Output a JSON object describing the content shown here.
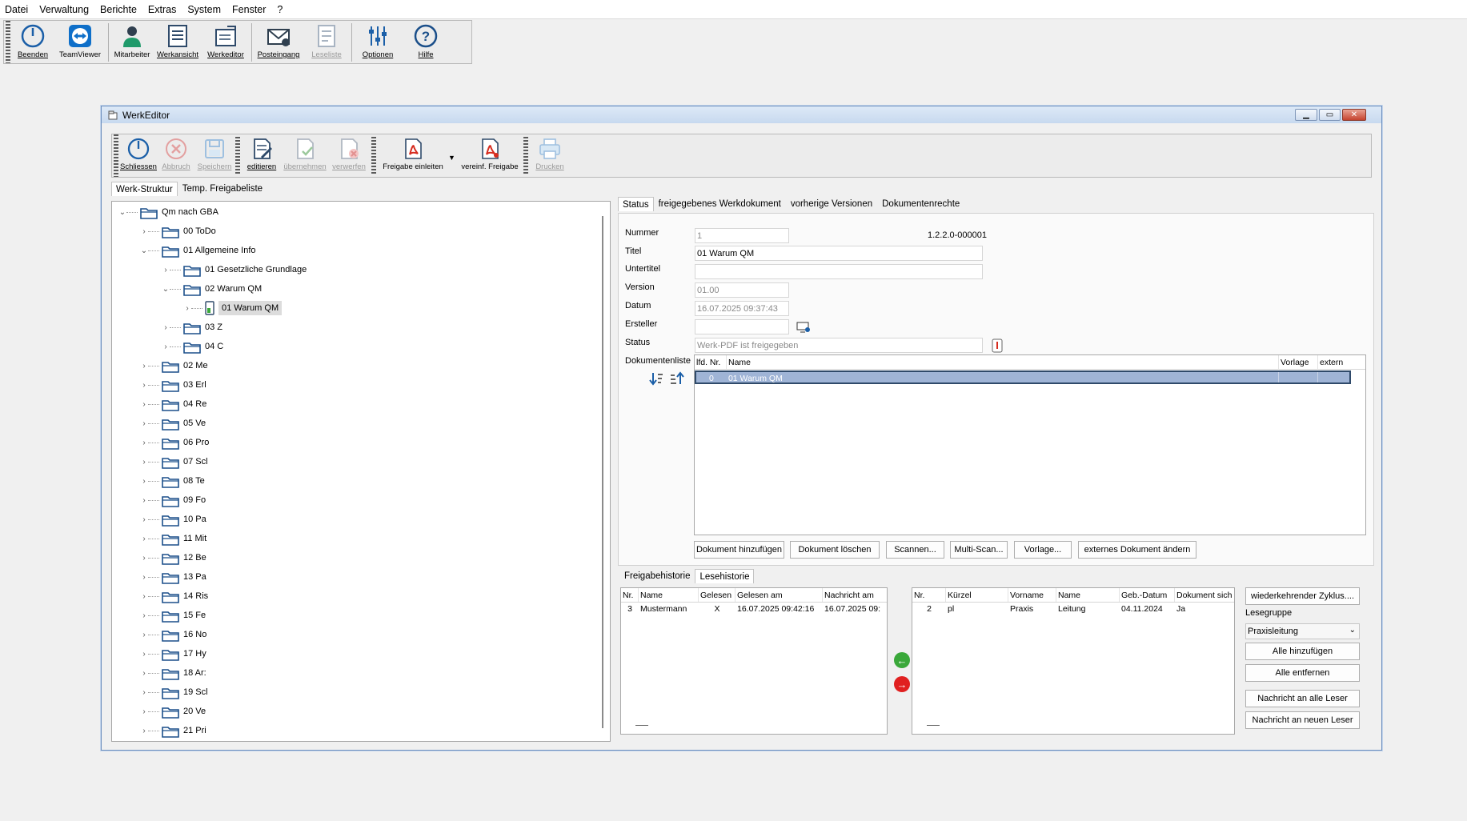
{
  "menu": [
    "Datei",
    "Verwaltung",
    "Berichte",
    "Extras",
    "System",
    "Fenster",
    "?"
  ],
  "main_toolbar": [
    {
      "label": "Beenden",
      "icon": "power-icon"
    },
    {
      "label": "TeamViewer",
      "icon": "teamviewer-icon"
    },
    {
      "label": "Mitarbeiter",
      "icon": "person-icon"
    },
    {
      "label": "Werkansicht",
      "icon": "document-list-icon"
    },
    {
      "label": "Werkeditor",
      "icon": "document-edit-icon"
    },
    {
      "label": "Posteingang",
      "icon": "mail-icon"
    },
    {
      "label": "Leseliste",
      "icon": "reading-list-icon"
    },
    {
      "label": "Optionen",
      "icon": "sliders-icon"
    },
    {
      "label": "Hilfe",
      "icon": "help-icon"
    }
  ],
  "window": {
    "title": "WerkEditor"
  },
  "editor_toolbar": [
    {
      "label": "Schliessen",
      "icon": "power-icon"
    },
    {
      "label": "Abbruch",
      "icon": "cancel-icon"
    },
    {
      "label": "Speichern",
      "icon": "save-icon"
    },
    {
      "label": "editieren",
      "icon": "edit-icon"
    },
    {
      "label": "übernehmen",
      "icon": "accept-icon"
    },
    {
      "label": "verwerfen",
      "icon": "discard-icon"
    },
    {
      "label": "Freigabe einleiten",
      "icon": "pdf-icon"
    },
    {
      "label": "vereinf. Freigabe",
      "icon": "pdf-icon"
    },
    {
      "label": "Drucken",
      "icon": "print-icon"
    }
  ],
  "left_tabs": [
    "Werk-Struktur",
    "Temp. Freigabeliste"
  ],
  "tree": [
    {
      "label": "Qm nach GBA",
      "expand": "v"
    },
    {
      "label": "00 ToDo",
      "expand": ">"
    },
    {
      "label": "01 Allgemeine Info",
      "expand": "v"
    },
    {
      "label": "01 Gesetzliche Grundlage",
      "expand": ">"
    },
    {
      "label": "02 Warum QM",
      "expand": "v"
    },
    {
      "label": "01 Warum QM",
      "expand": ">"
    },
    {
      "label": "03 Z",
      "expand": ">"
    },
    {
      "label": "04 C",
      "expand": ">"
    },
    {
      "label": "02 Me",
      "expand": ">"
    },
    {
      "label": "03 Erl",
      "expand": ">"
    },
    {
      "label": "04 Re",
      "expand": ">"
    },
    {
      "label": "05 Ve",
      "expand": ">"
    },
    {
      "label": "06 Pro",
      "expand": ">"
    },
    {
      "label": "07 Scl",
      "expand": ">"
    },
    {
      "label": "08 Te",
      "expand": ">"
    },
    {
      "label": "09 Fo",
      "expand": ">"
    },
    {
      "label": "10 Pa",
      "expand": ">"
    },
    {
      "label": "11 Mit",
      "expand": ">"
    },
    {
      "label": "12 Be",
      "expand": ">"
    },
    {
      "label": "13 Pa",
      "expand": ">"
    },
    {
      "label": "14 Ris",
      "expand": ">"
    },
    {
      "label": "15 Fe",
      "expand": ">"
    },
    {
      "label": "16 No",
      "expand": ">"
    },
    {
      "label": "17 Hy",
      "expand": ">"
    },
    {
      "label": "18 Ar:",
      "expand": ">"
    },
    {
      "label": "19 Scl",
      "expand": ">"
    },
    {
      "label": "20 Ve",
      "expand": ">"
    },
    {
      "label": "21 Pri",
      "expand": ">"
    }
  ],
  "right_tabs": [
    "Status",
    "freigegebenes Werkdokument",
    "vorherige Versionen",
    "Dokumentenrechte"
  ],
  "form": {
    "nummer_label": "Nummer",
    "nummer": "1",
    "code": "1.2.2.0-000001",
    "titel_label": "Titel",
    "titel": "01 Warum QM",
    "untertitel_label": "Untertitel",
    "untertitel": "",
    "version_label": "Version",
    "version": "01.00",
    "datum_label": "Datum",
    "datum": "16.07.2025 09:37:43",
    "ersteller_label": "Ersteller",
    "ersteller": "",
    "status_label": "Status",
    "status": "Werk-PDF ist freigegeben",
    "dokumentenliste_label": "Dokumentenliste"
  },
  "doc_columns": [
    "lfd. Nr.",
    "Name",
    "Vorlage",
    "extern"
  ],
  "doc_rows": [
    {
      "nr": "0",
      "name": "01 Warum QM",
      "vorlage": "",
      "extern": ""
    }
  ],
  "doc_buttons": [
    "Dokument hinzufügen",
    "Dokument löschen",
    "Scannen...",
    "Multi-Scan...",
    "Vorlage...",
    "externes Dokument ändern"
  ],
  "bottom_tabs": [
    "Freigabehistorie",
    "Lesehistorie"
  ],
  "read_columns": [
    "Nr.",
    "Name",
    "Gelesen",
    "Gelesen am",
    "Nachricht am"
  ],
  "read_rows": [
    {
      "nr": "3",
      "name": "Mustermann",
      "gelesen": "X",
      "gelesen_am": "16.07.2025 09:42:16",
      "nachricht_am": "16.07.2025 09:"
    }
  ],
  "reader_columns": [
    "Nr.",
    "Kürzel",
    "Vorname",
    "Name",
    "Geb.-Datum",
    "Dokument sich"
  ],
  "reader_rows": [
    {
      "nr": "2",
      "kuerzel": "pl",
      "vorname": "Praxis",
      "name": "Leitung",
      "geb": "04.11.2024",
      "dok": "Ja"
    }
  ],
  "side": {
    "zyklus_button": "wiederkehrender Zyklus....",
    "lesegruppe_label": "Lesegruppe",
    "lesegruppe_value": "Praxisleitung",
    "alle_hinzufuegen": "Alle hinzufügen",
    "alle_entfernen": "Alle entfernen",
    "nachricht_alle": "Nachricht an alle Leser",
    "nachricht_neue": "Nachricht an neuen Leser"
  },
  "colors": {
    "selection": "#9fb4d6",
    "accent": "#1b5fa8",
    "pdf_red": "#d62c1f",
    "add_green": "#3aa83a",
    "remove_red": "#e02020"
  }
}
